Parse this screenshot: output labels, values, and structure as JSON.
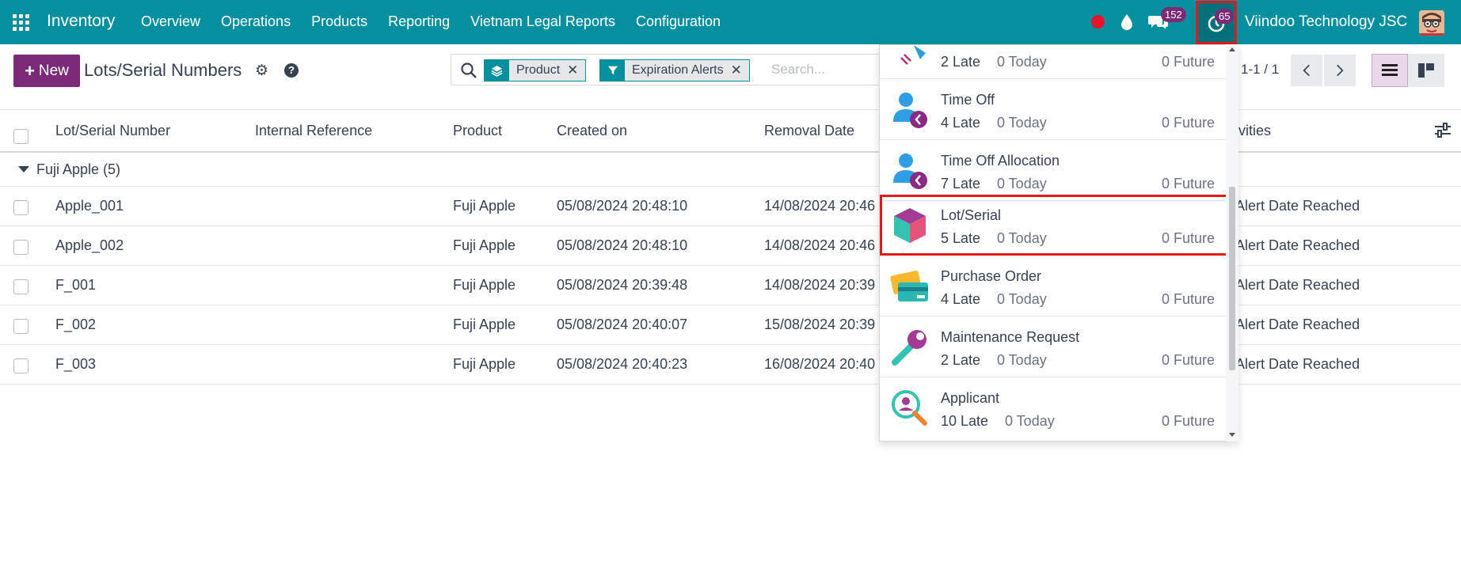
{
  "navbar": {
    "app_name": "Inventory",
    "menu": [
      "Overview",
      "Operations",
      "Products",
      "Reporting",
      "Vietnam Legal Reports",
      "Configuration"
    ],
    "messages_badge": "152",
    "activities_badge": "65",
    "company": "Viindoo Technology JSC",
    "icons": [
      "apps-grid-icon",
      "record-dot-icon",
      "drop-icon",
      "chat-icon",
      "clock-activity-icon",
      "avatar"
    ]
  },
  "control": {
    "new_label": "New",
    "breadcrumb": "Lots/Serial Numbers",
    "facets": [
      {
        "icon": "layers-icon",
        "label": "Product"
      },
      {
        "icon": "filter-icon",
        "label": "Expiration Alerts"
      }
    ],
    "search_placeholder": "Search...",
    "pager": "1-1 / 1"
  },
  "table": {
    "headers": [
      "Lot/Serial Number",
      "Internal Reference",
      "Product",
      "Created on",
      "Removal Date",
      "ivities"
    ],
    "group": "Fuji Apple (5)",
    "rows": [
      {
        "lot": "Apple_001",
        "ref": "",
        "product": "Fuji Apple",
        "created": "05/08/2024 20:48:10",
        "removal": "14/08/2024 20:46",
        "activity": "Alert Date Reached"
      },
      {
        "lot": "Apple_002",
        "ref": "",
        "product": "Fuji Apple",
        "created": "05/08/2024 20:48:10",
        "removal": "14/08/2024 20:46",
        "activity": "Alert Date Reached"
      },
      {
        "lot": "F_001",
        "ref": "",
        "product": "Fuji Apple",
        "created": "05/08/2024 20:39:48",
        "removal": "14/08/2024 20:39",
        "activity": "Alert Date Reached"
      },
      {
        "lot": "F_002",
        "ref": "",
        "product": "Fuji Apple",
        "created": "05/08/2024 20:40:07",
        "removal": "15/08/2024 20:39",
        "activity": "Alert Date Reached"
      },
      {
        "lot": "F_003",
        "ref": "",
        "product": "Fuji Apple",
        "created": "05/08/2024 20:40:23",
        "removal": "16/08/2024 20:40",
        "activity": "Alert Date Reached"
      }
    ]
  },
  "activities": [
    {
      "name": "",
      "late": "2 Late",
      "today": "0 Today",
      "future": "0 Future",
      "icon": "partial-icon"
    },
    {
      "name": "Time Off",
      "late": "4 Late",
      "today": "0 Today",
      "future": "0 Future",
      "icon": "time-off-icon"
    },
    {
      "name": "Time Off Allocation",
      "late": "7 Late",
      "today": "0 Today",
      "future": "0 Future",
      "icon": "time-off-allocation-icon"
    },
    {
      "name": "Lot/Serial",
      "late": "5 Late",
      "today": "0 Today",
      "future": "0 Future",
      "icon": "cube-icon"
    },
    {
      "name": "Purchase Order",
      "late": "4 Late",
      "today": "0 Today",
      "future": "0 Future",
      "icon": "credit-card-icon"
    },
    {
      "name": "Maintenance Request",
      "late": "2 Late",
      "today": "0 Today",
      "future": "0 Future",
      "icon": "wrench-icon"
    },
    {
      "name": "Applicant",
      "late": "10 Late",
      "today": "0 Today",
      "future": "0 Future",
      "icon": "applicant-search-icon"
    }
  ],
  "colors": {
    "navbar": "#06909f",
    "brand_purple": "#7a2a77",
    "highlight_red": "#e01b1b"
  }
}
